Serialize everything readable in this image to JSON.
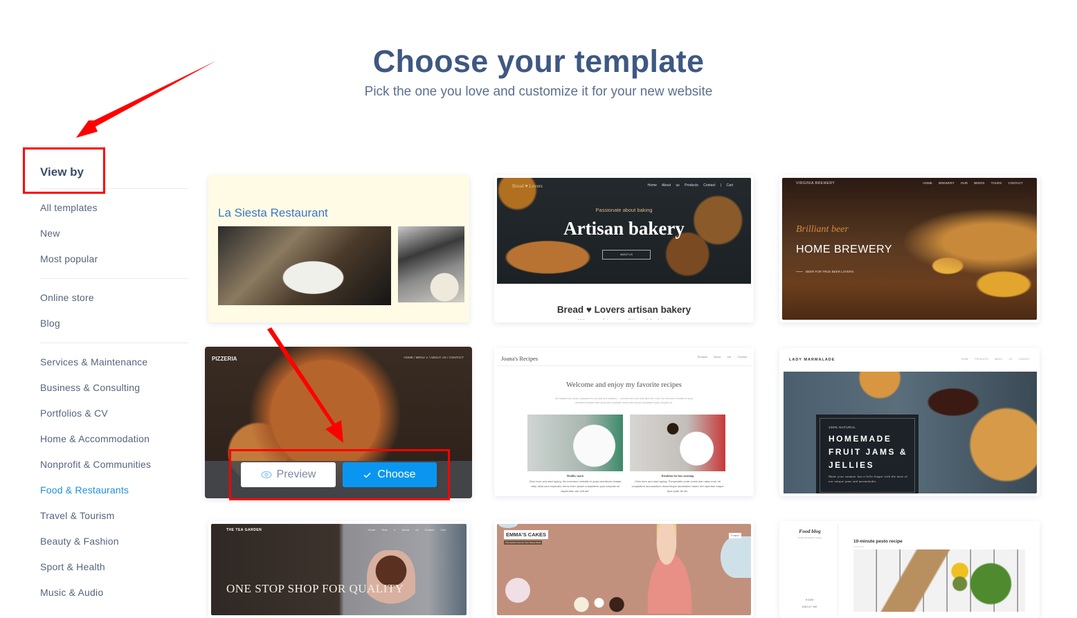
{
  "header": {
    "title": "Choose your template",
    "subtitle": "Pick the one you love and customize it for your new website"
  },
  "sidebar": {
    "heading": "View by",
    "groups": [
      {
        "items": [
          "All templates",
          "New",
          "Most popular"
        ]
      },
      {
        "items": [
          "Online store",
          "Blog"
        ]
      },
      {
        "items": [
          "Services & Maintenance",
          "Business & Consulting",
          "Portfolios & CV",
          "Home & Accommodation",
          "Nonprofit & Communities",
          "Food & Restaurants",
          "Travel & Tourism",
          "Beauty & Fashion",
          "Sport & Health",
          "Music & Audio"
        ]
      }
    ],
    "active_item": "Food & Restaurants",
    "active_color": "#1e8fd8"
  },
  "templates": [
    {
      "name": "La Siesta Restaurant",
      "title": "La Siesta Restaurant"
    },
    {
      "name": "Bread Lovers",
      "logo": "Bread ♥ Lovers",
      "nav": "Home  About us  Products  Contact  |  Cart",
      "kicker": "Passionate about baking",
      "headline": "Artisan bakery",
      "button": "ABOUT US",
      "tagline": "Bread ♥ Lovers artisan bakery",
      "sub": "We combine traditional baking"
    },
    {
      "name": "Virginia Brewery",
      "logo": "VIRGINIA BREWERY",
      "nav": "HOME  BREWERY  OUR BEERS  TOURS  CONTACT",
      "script": "Brilliant beer",
      "headline": "HOME BREWERY",
      "sub": "BEER FOR TRUE BEER LOVERS"
    },
    {
      "name": "Pizzeria",
      "logo": "PIZZERIA",
      "nav": "HOME / MENU ∨ / ABOUT US / CONTACT",
      "hover": true,
      "preview_label": "Preview",
      "choose_label": "Choose"
    },
    {
      "name": "Joana's Recipes",
      "logo": "Joana's Recipes",
      "nav": "Recipes  About me  Contact",
      "welcome": "Welcome and enjoy my favorite recipes",
      "lede": "Get inspired by meals I prepared for my kids and husband – I present the ones they liked the most. Illo inventore veritatis et quasi architecto beatae vitae dicta sunt explicabo nemo enim ipsam voluptatem quia voluptas sit.",
      "cards": [
        {
          "caption": "Healthy snack",
          "text": "Click here and start typing. Illo inventore veritatis et quasi architecto beatae vitae dicta sunt explicabo nemo enim ipsam voluptatem quia voluptas sit aspernatur aut odit aut."
        },
        {
          "caption": "Breakfast for lazy morning",
          "text": "Click here and start typing. Perspiciatis unde omnis iste natus error sit voluptatem accusantium doloremque laudantium totam rem aperiam eaque ipsa quae ab illo."
        }
      ]
    },
    {
      "name": "Lady Marmalade",
      "logo": "LADY MARMALADE",
      "nav": "HOME  PRODUCTS  ABOUT US  CONTACT",
      "kicker": "100% NATURAL",
      "headline": "HOMEMADE FRUIT JAMS & JELLIES",
      "body": "Make your summer last a little longer with the taste of our unique jams and marmalades."
    },
    {
      "name": "The Tea Garden",
      "logo": "THE TEA GARDEN",
      "nav": "Home  Teas ∨  About us  Contact  Cart",
      "headline": "ONE STOP SHOP FOR QUALITY"
    },
    {
      "name": "Emma's Cakes",
      "logo": "EMMA'S CAKES",
      "tag": "The Perfect Cure for Your Sweet Tooth",
      "menu": "☰ MENU"
    },
    {
      "name": "Food blog",
      "logo": "Food blog",
      "sub": "Quick and healthy recipes",
      "post_title": "10-minute pesto recipe",
      "date": "21.09.2016",
      "nav": [
        "HOME",
        "ABOUT ME"
      ]
    }
  ],
  "icons": {
    "preview": "eye-icon",
    "choose": "checkmark-icon"
  },
  "annotations": {
    "color": "#ff0000"
  }
}
